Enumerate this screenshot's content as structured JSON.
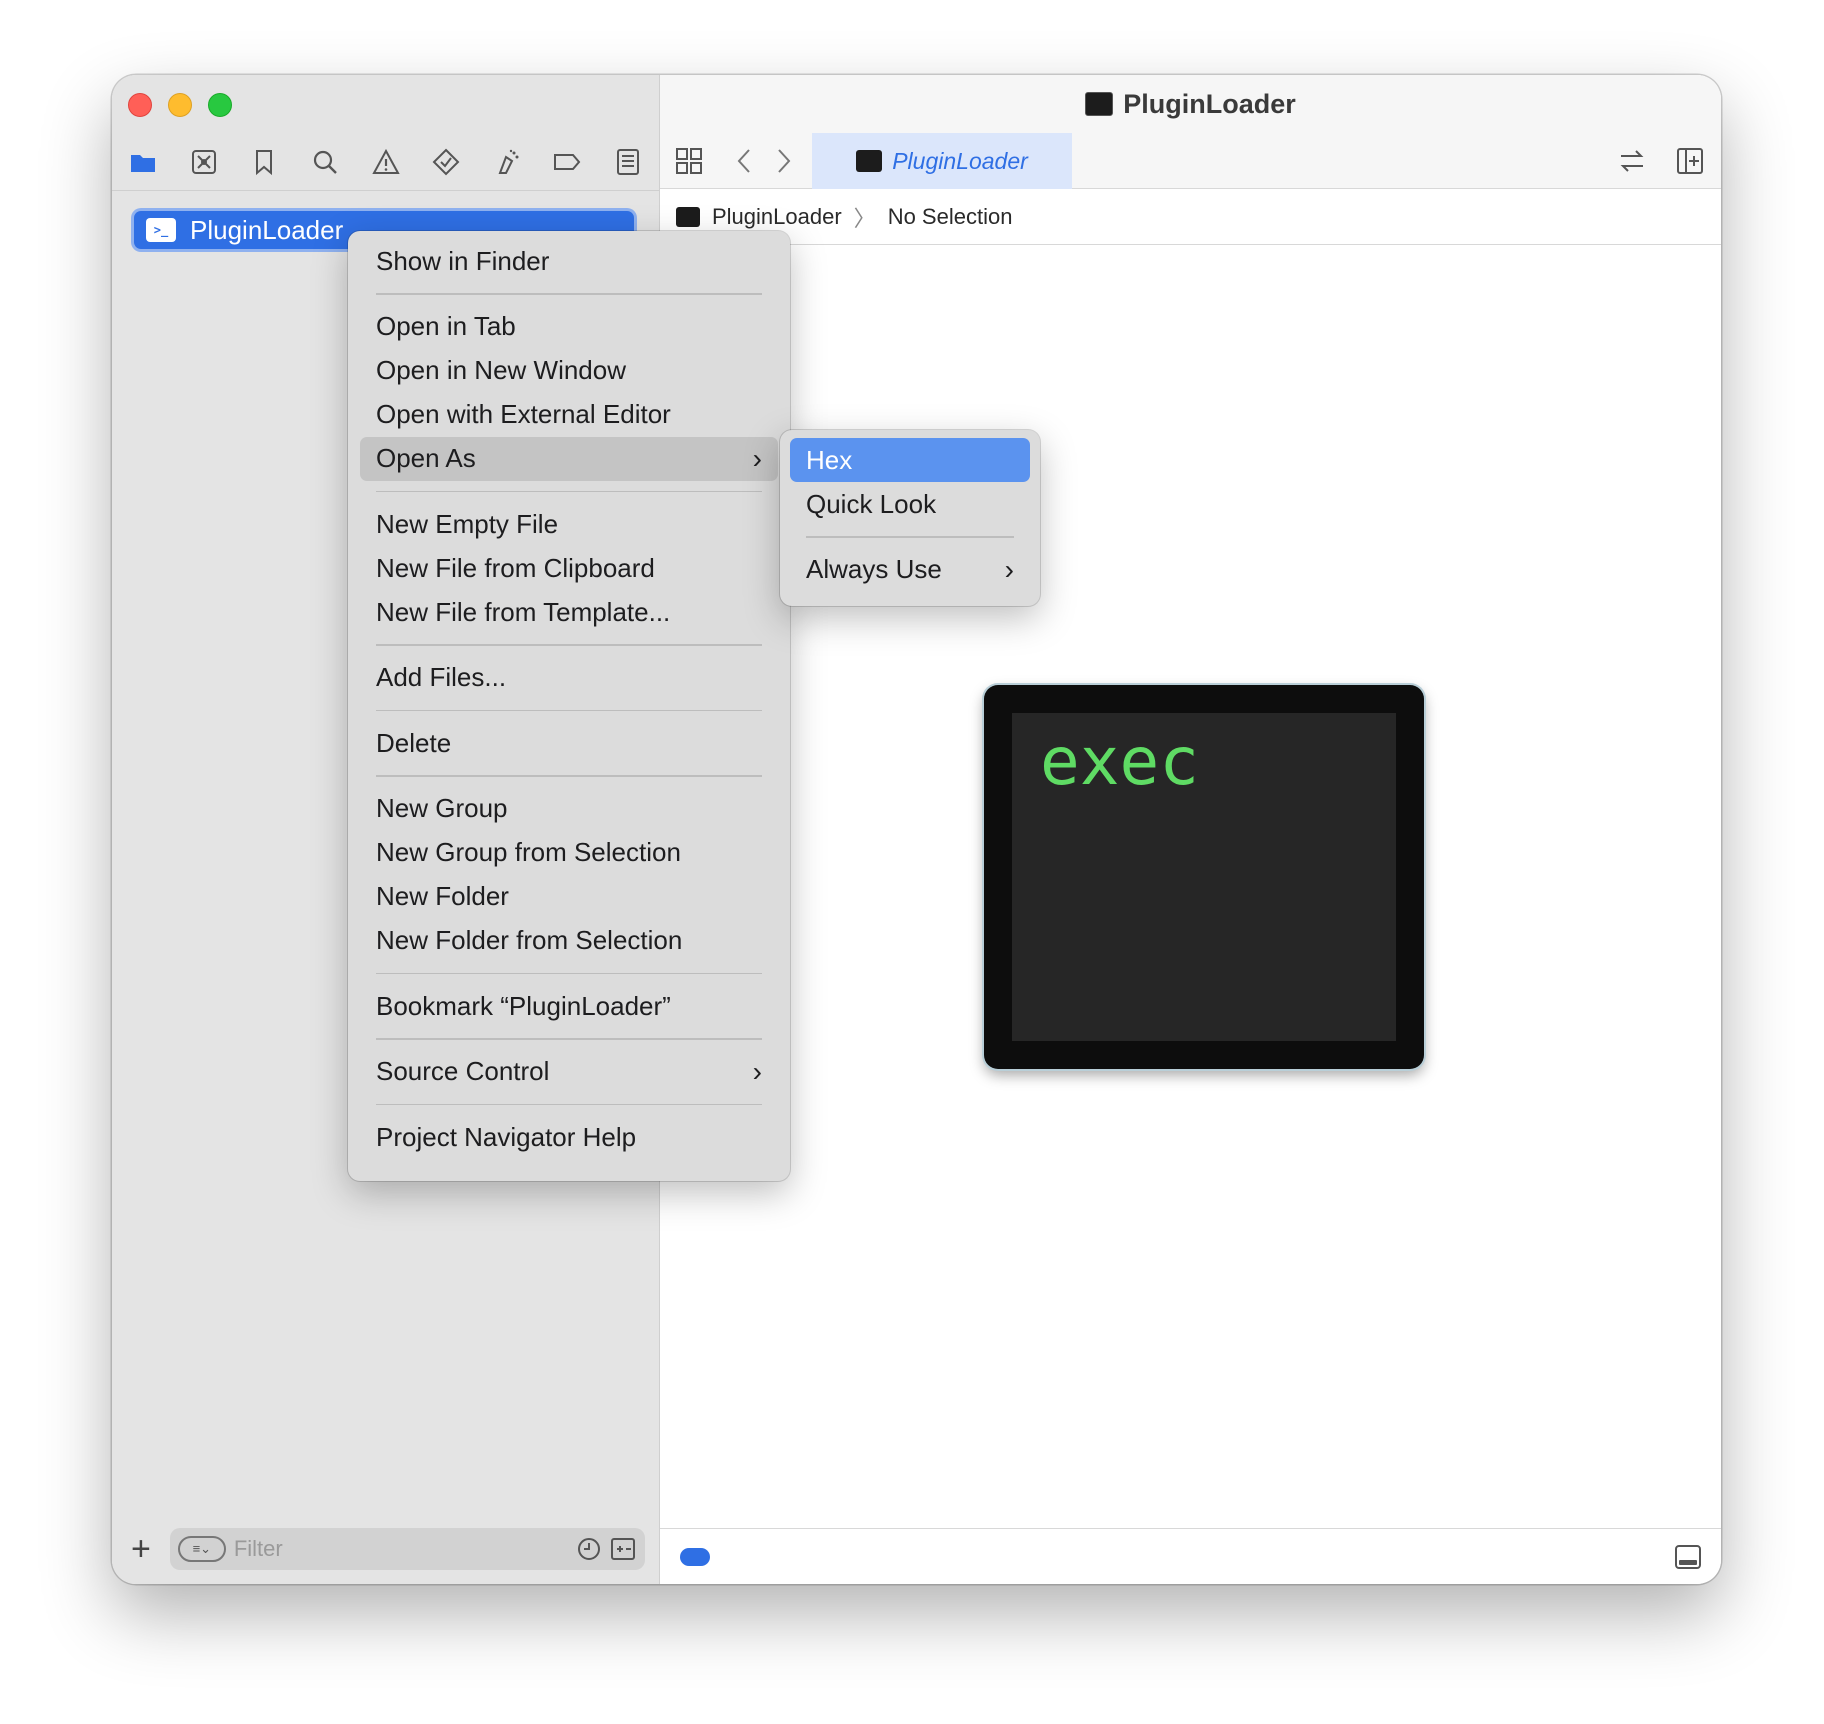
{
  "window": {
    "title": "PluginLoader"
  },
  "sidebar": {
    "navigator_icons": [
      "folder-icon",
      "source-control-icon",
      "bookmark-icon",
      "find-icon",
      "warning-icon",
      "test-icon",
      "debug-icon",
      "breakpoint-icon",
      "report-icon"
    ],
    "tree": {
      "selected_item": "PluginLoader"
    },
    "filter": {
      "placeholder": "Filter"
    }
  },
  "editor": {
    "tab_label": "PluginLoader",
    "jumpbar": {
      "file": "PluginLoader",
      "selection": "No Selection"
    },
    "preview": {
      "text": "exec"
    }
  },
  "context_menu": {
    "items": [
      "Show in Finder",
      "Open in Tab",
      "Open in New Window",
      "Open with External Editor",
      "Open As",
      "New Empty File",
      "New File from Clipboard",
      "New File from Template...",
      "Add Files...",
      "Delete",
      "New Group",
      "New Group from Selection",
      "New Folder",
      "New Folder from Selection",
      "Bookmark “PluginLoader”",
      "Source Control",
      "Project Navigator Help"
    ]
  },
  "submenu": {
    "items": [
      "Hex",
      "Quick Look",
      "Always Use"
    ]
  },
  "colors": {
    "accent": "#2f6fe4",
    "selection": "#5b93ef",
    "terminal_green": "#5fdb64"
  }
}
